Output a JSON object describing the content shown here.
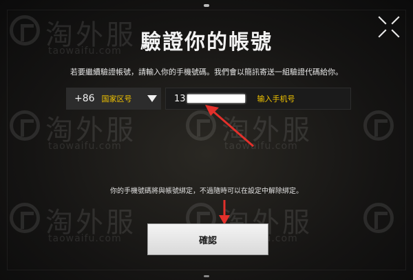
{
  "dialog": {
    "title": "驗證你的帳號",
    "subtitle": "若要繼續驗證帳號，請輸入你的手機號碼。我們會以簡訊寄送一組驗證代碼給你。",
    "close_icon": "close-icon"
  },
  "country_selector": {
    "code": "+86",
    "annotation": "国家区号",
    "icon": "triangle-down-icon"
  },
  "phone_input": {
    "value": "13",
    "annotation": "输入手机号"
  },
  "note": "你的手機號碼將與帳號綁定，不過隨時可以在設定中解除綁定。",
  "confirm_label": "確認",
  "watermark": {
    "cn": "淘外服",
    "en": "taowaifu.com"
  },
  "colors": {
    "annotation": "#f2c400",
    "arrow": "#e3302b",
    "button_bg": "#eeeeee"
  }
}
